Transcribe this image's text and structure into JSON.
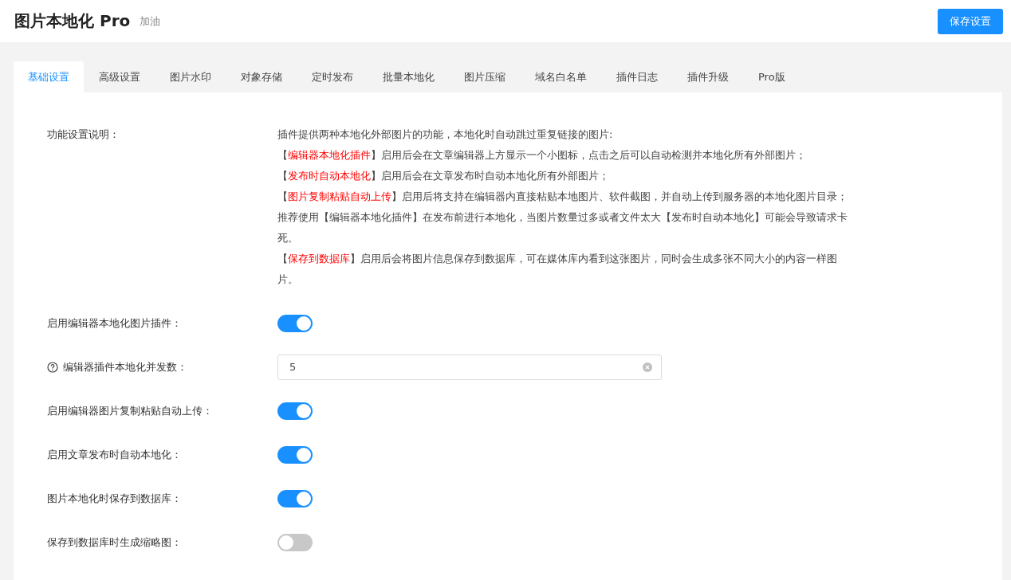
{
  "header": {
    "title": "图片本地化",
    "title_suffix": "Pro",
    "badge": "加油",
    "save_button": "保存设置"
  },
  "tabs": [
    {
      "label": "基础设置",
      "selected": true
    },
    {
      "label": "高级设置",
      "selected": false
    },
    {
      "label": "图片水印",
      "selected": false
    },
    {
      "label": "对象存储",
      "selected": false
    },
    {
      "label": "定时发布",
      "selected": false
    },
    {
      "label": "批量本地化",
      "selected": false
    },
    {
      "label": "图片压缩",
      "selected": false
    },
    {
      "label": "域名白名单",
      "selected": false
    },
    {
      "label": "插件日志",
      "selected": false
    },
    {
      "label": "插件升级",
      "selected": false
    },
    {
      "label": "Pro版",
      "selected": false
    }
  ],
  "description": {
    "label": "功能设置说明：",
    "paragraphs": [
      [
        {
          "text": "插件提供两种本地化外部图片的功能，本地化时自动跳过重复链接的图片:",
          "highlight": false
        }
      ],
      [
        {
          "text": "【",
          "highlight": false
        },
        {
          "text": "编辑器本地化插件",
          "highlight": true
        },
        {
          "text": "】启用后会在文章编辑器上方显示一个小图标，点击之后可以自动检测并本地化所有外部图片；",
          "highlight": false
        }
      ],
      [
        {
          "text": "【",
          "highlight": false
        },
        {
          "text": "发布时自动本地化",
          "highlight": true
        },
        {
          "text": "】启用后会在文章发布时自动本地化所有外部图片；",
          "highlight": false
        }
      ],
      [
        {
          "text": "【",
          "highlight": false
        },
        {
          "text": "图片复制粘贴自动上传",
          "highlight": true
        },
        {
          "text": "】启用后将支持在编辑器内直接粘贴本地图片、软件截图，并自动上传到服务器的本地化图片目录；",
          "highlight": false
        }
      ],
      [
        {
          "text": "推荐使用【编辑器本地化插件】在发布前进行本地化，当图片数量过多或者文件太大【发布时自动本地化】可能会导致请求卡死。",
          "highlight": false
        }
      ],
      [
        {
          "text": "【",
          "highlight": false
        },
        {
          "text": "保存到数据库",
          "highlight": true
        },
        {
          "text": "】启用后会将图片信息保存到数据库，可在媒体库内看到这张图片，同时会生成多张不同大小的内容一样图片。",
          "highlight": false
        }
      ]
    ]
  },
  "settings": [
    {
      "kind": "toggle",
      "label": "启用编辑器本地化图片插件：",
      "help_icon": false,
      "on": true
    },
    {
      "kind": "number",
      "label": "编辑器插件本地化并发数：",
      "help_icon": true,
      "value": "5"
    },
    {
      "kind": "toggle",
      "label": "启用编辑器图片复制粘贴自动上传：",
      "help_icon": false,
      "on": true
    },
    {
      "kind": "toggle",
      "label": "启用文章发布时自动本地化：",
      "help_icon": false,
      "on": true
    },
    {
      "kind": "toggle",
      "label": "图片本地化时保存到数据库：",
      "help_icon": false,
      "on": true
    },
    {
      "kind": "toggle",
      "label": "保存到数据库时生成缩略图：",
      "help_icon": false,
      "on": false
    }
  ]
}
